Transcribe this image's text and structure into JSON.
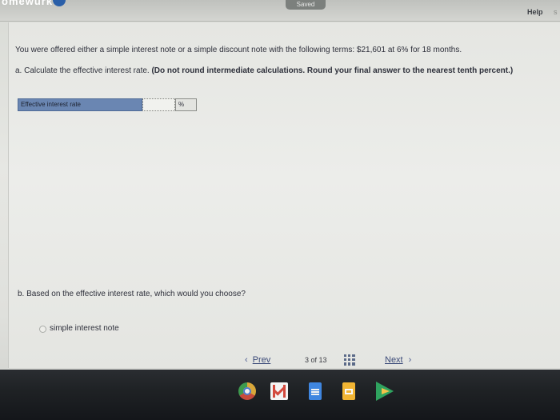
{
  "header": {
    "app_title": "omewurk",
    "saved_label": "Saved",
    "help_label": "Help",
    "edge_letter": "s"
  },
  "question": {
    "text": "You were offered either a simple interest note or a simple discount note with the following terms: $21,601 at 6% for 18 months.",
    "part_a": {
      "prefix": "a. Calculate the effective interest rate. ",
      "instruction": "(Do not round intermediate calculations. Round your final answer to the nearest tenth percent.)"
    },
    "answer_row": {
      "label": "Effective interest rate",
      "value": "",
      "unit": "%"
    },
    "part_b": "b. Based on the effective interest rate, which would you choose?",
    "options": [
      {
        "label": "simple interest note",
        "selected": false
      }
    ]
  },
  "navigation": {
    "prev_label": "Prev",
    "page_indicator": "3 of 13",
    "next_label": "Next",
    "prev_icon": "chevron-left-icon",
    "next_icon": "chevron-right-icon",
    "grid_icon": "grid-icon"
  },
  "shelf": {
    "apps": [
      "chrome-icon",
      "gmail-icon",
      "docs-icon",
      "slides-icon",
      "play-store-icon"
    ]
  },
  "colors": {
    "answer_label_bg": "#6a86b2",
    "link": "#3a4a78",
    "shelf": "#1f2225"
  }
}
